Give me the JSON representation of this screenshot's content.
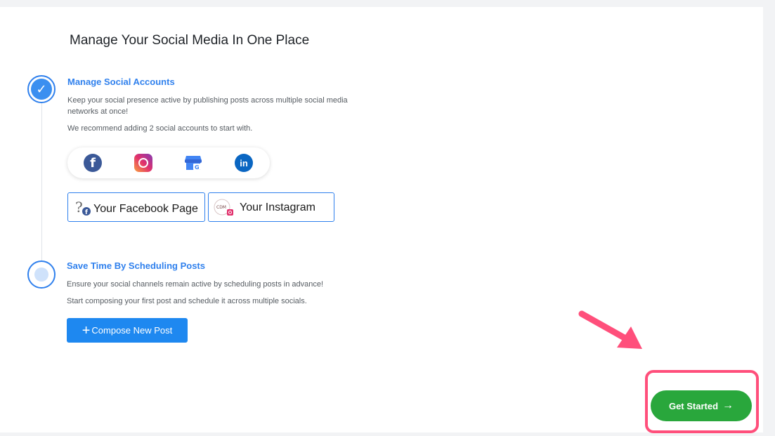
{
  "page": {
    "title": "Manage Your Social Media In One Place"
  },
  "step1": {
    "title": "Manage Social Accounts",
    "desc1": "Keep your social presence active by publishing posts across multiple social media networks at once!",
    "desc2": "We recommend adding 2 social accounts to start with.",
    "check": "✓"
  },
  "socials": {
    "facebook_glyph": "f",
    "linkedin_glyph": "in",
    "icons": [
      "facebook-icon",
      "instagram-icon",
      "google-business-icon",
      "linkedin-icon"
    ]
  },
  "accounts": [
    {
      "label": "Your Facebook Page",
      "icon": "facebook-page-avatar-icon"
    },
    {
      "label": "Your Instagram",
      "icon": "instagram-avatar-icon"
    }
  ],
  "step2": {
    "title": "Save Time By Scheduling Posts",
    "desc1": "Ensure your social channels remain active by scheduling posts in advance!",
    "desc2": "Start composing your first post and schedule it across multiple socials.",
    "compose_label": "Compose New Post",
    "compose_plus": "+"
  },
  "footer": {
    "get_started_label": "Get Started",
    "arrow": "→"
  },
  "colors": {
    "accent": "#2f80ed",
    "primary_button": "#1e88f0",
    "success": "#29a73c",
    "highlight": "#ff4f7b"
  }
}
